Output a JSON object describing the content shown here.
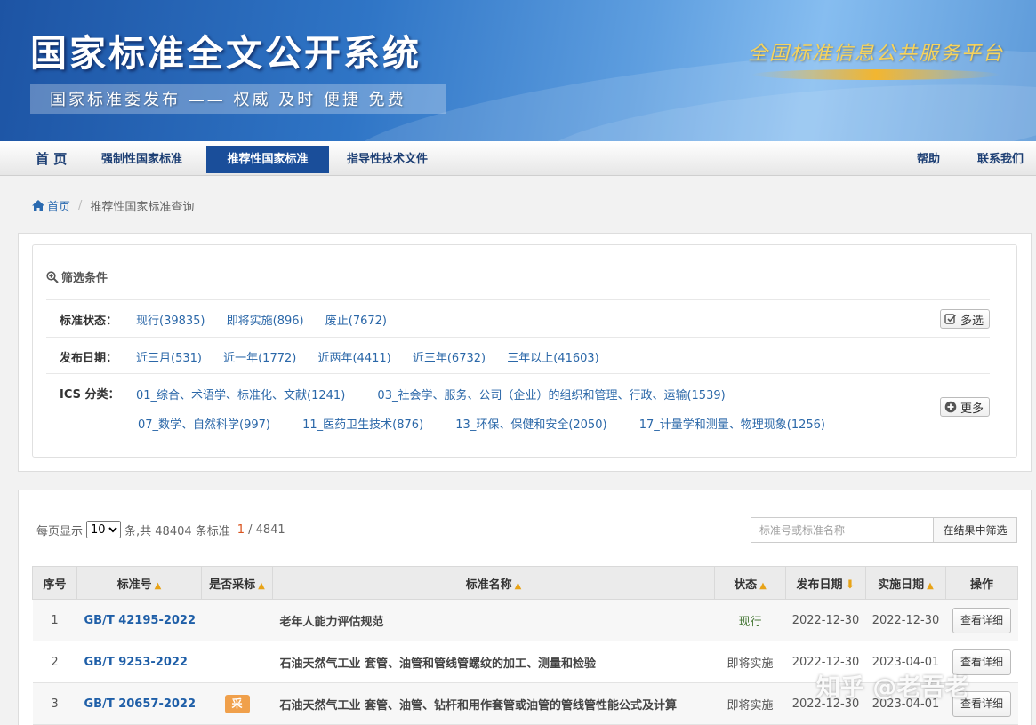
{
  "banner": {
    "title": "国家标准全文公开系统",
    "subtitle": "国家标准委发布 —— 权威 及时 便捷 免费",
    "platform": "全国标准信息公共服务平台"
  },
  "nav": {
    "home": "首 页",
    "mandatory": "强制性国家标准",
    "recommended": "推荐性国家标准",
    "guidance": "指导性技术文件",
    "help": "帮助",
    "contact": "联系我们"
  },
  "breadcrumb": {
    "home": "首页",
    "current": "推荐性国家标准查询"
  },
  "filter": {
    "title": "筛选条件",
    "status_label": "标准状态：",
    "status_options": [
      "现行(39835)",
      "即将实施(896)",
      "废止(7672)"
    ],
    "multi_select": "多选",
    "date_label": "发布日期：",
    "date_options": [
      "近三月(531)",
      "近一年(1772)",
      "近两年(4411)",
      "近三年(6732)",
      "三年以上(41603)"
    ],
    "ics_label": "ICS 分类：",
    "ics_row1": [
      "01_综合、术语学、标准化、文献(1241)",
      "03_社会学、服务、公司（企业）的组织和管理、行政、运输(1539)"
    ],
    "ics_row2": [
      "07_数学、自然科学(997)",
      "11_医药卫生技术(876)",
      "13_环保、保健和安全(2050)",
      "17_计量学和测量、物理现象(1256)"
    ],
    "more": "更多"
  },
  "pagination": {
    "per_page_prefix": "每页显示",
    "per_page_value": "10",
    "total_text": "条,共 48404 条标准",
    "current_page": "1",
    "total_pages": "/ 4841"
  },
  "search": {
    "placeholder": "标准号或标准名称",
    "button": "在结果中筛选"
  },
  "table": {
    "headers": {
      "seq": "序号",
      "code": "标准号",
      "adopted": "是否采标",
      "name": "标准名称",
      "status": "状态",
      "pub_date": "发布日期",
      "impl_date": "实施日期",
      "action": "操作"
    },
    "rows": [
      {
        "seq": "1",
        "code": "GB/T 42195-2022",
        "adopted": "",
        "name": "老年人能力评估规范",
        "status": "现行",
        "pub_date": "2022-12-30",
        "impl_date": "2022-12-30",
        "action": "查看详细"
      },
      {
        "seq": "2",
        "code": "GB/T 9253-2022",
        "adopted": "",
        "name": "石油天然气工业 套管、油管和管线管螺纹的加工、测量和检验",
        "status": "即将实施",
        "pub_date": "2022-12-30",
        "impl_date": "2023-04-01",
        "action": "查看详细"
      },
      {
        "seq": "3",
        "code": "GB/T 20657-2022",
        "adopted": "采",
        "name": "石油天然气工业 套管、油管、钻杆和用作套管或油管的管线管性能公式及计算",
        "status": "即将实施",
        "pub_date": "2022-12-30",
        "impl_date": "2023-04-01",
        "action": "查看详细"
      }
    ]
  },
  "watermark": "知乎 @老吾老",
  "colors": {
    "nav_active": "#1a4e9a",
    "link": "#2a67a8",
    "adopted_badge": "#f0a04b",
    "sort_arrow": "#e8a317"
  }
}
